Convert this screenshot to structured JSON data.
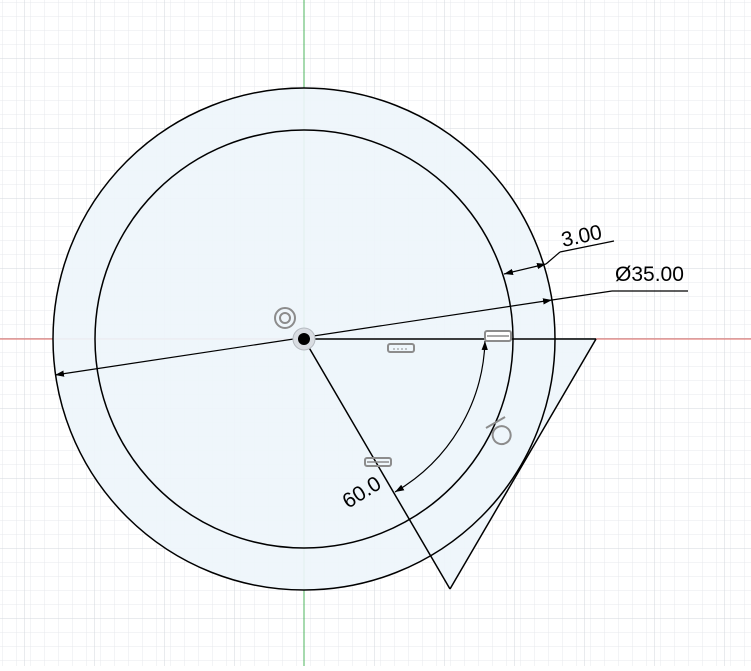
{
  "sketch": {
    "dimensions": {
      "wall_thickness": "3.00",
      "diameter": "Ø35.00",
      "angle": "60.0"
    }
  },
  "colors": {
    "background": "#ffffff",
    "grid_minor": "#e7e9ec",
    "grid_major": "#d3d7dc",
    "x_axis": "#e0665f",
    "y_axis": "#4cb45c",
    "profile_fill": "#eef5fb",
    "sketch_line": "#000000",
    "constraint_icon": "#8c8c8c"
  },
  "icons": {
    "origin_constraint": "concentric-icon",
    "horizontal_constraint": "horizontal-constraint-icon",
    "coincident_constraint": "tangent-icon"
  }
}
